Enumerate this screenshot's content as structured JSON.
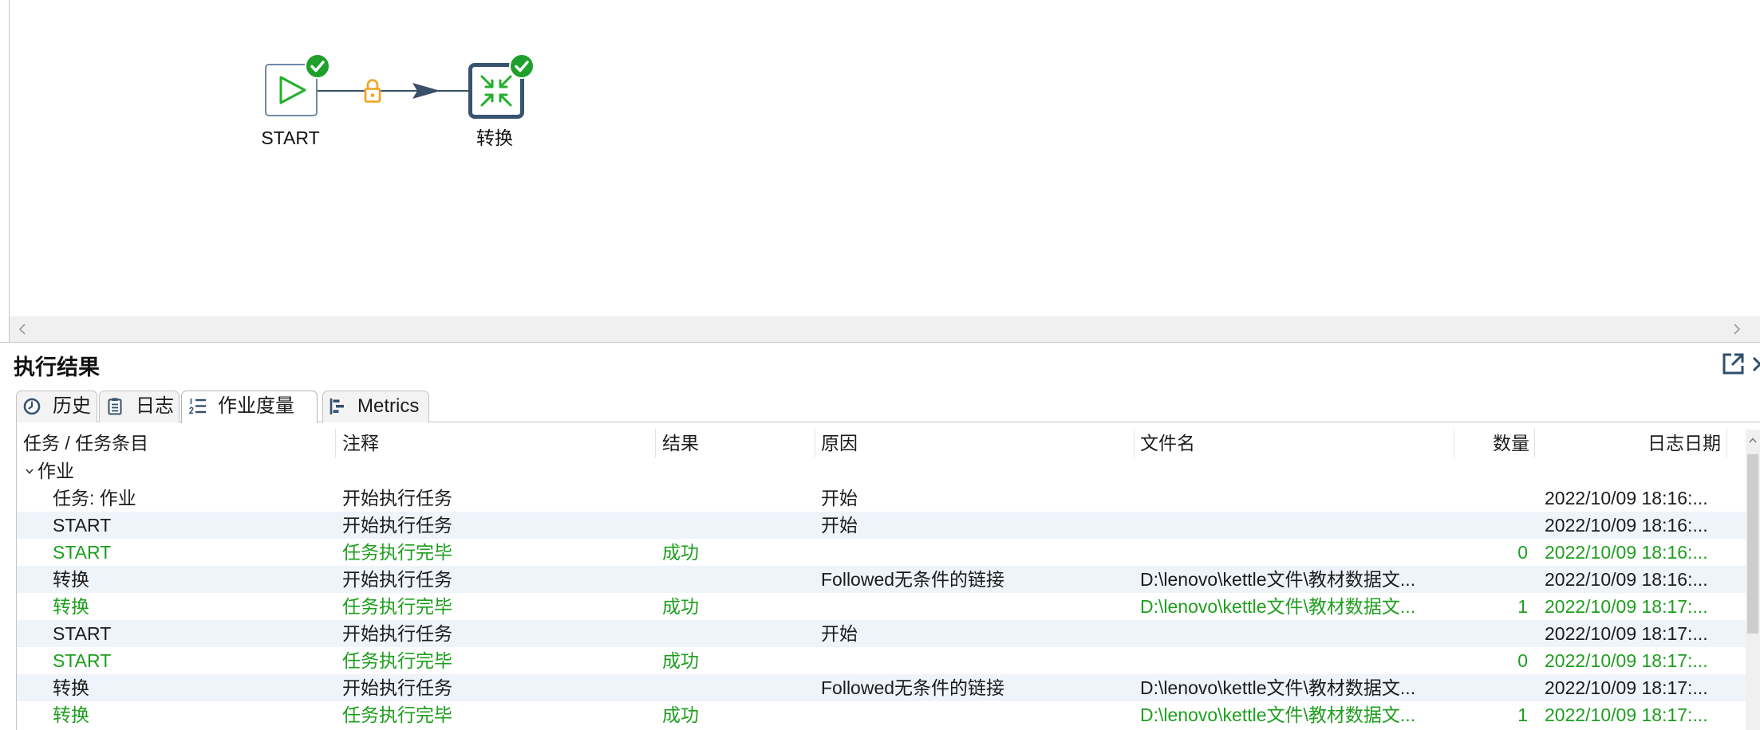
{
  "canvas": {
    "start_node": {
      "label": "START",
      "icon": "play-icon",
      "status": "success"
    },
    "transform_node": {
      "label": "转换",
      "icon": "compress-arrows-icon",
      "status": "success"
    },
    "hop": {
      "icon": "lock-icon",
      "arrow": "arrow-head-icon"
    },
    "hscroll": {
      "left_icon": "chevron-left-icon",
      "right_icon": "chevron-right-icon"
    }
  },
  "panel": {
    "title": "执行结果",
    "actions": [
      "external-link-icon",
      "close-icon"
    ],
    "tabs": [
      {
        "label": "历史",
        "icon": "clock-icon",
        "active": false
      },
      {
        "label": "日志",
        "icon": "log-document-icon",
        "active": false
      },
      {
        "label": "作业度量",
        "icon": "numbered-list-icon",
        "active": true
      },
      {
        "label": "Metrics",
        "icon": "gantt-chart-icon",
        "active": false
      }
    ]
  },
  "table": {
    "columns": [
      "任务 / 任务条目",
      "注释",
      "结果",
      "原因",
      "文件名",
      "数量",
      "日志日期"
    ],
    "group": {
      "label": "作业",
      "expanded": true
    },
    "rows": [
      {
        "task": "任务: 作业",
        "comment": "开始执行任务",
        "result": "",
        "reason": "开始",
        "file": "",
        "count": "",
        "date": "2022/10/09 18:16:...",
        "success": false
      },
      {
        "task": "START",
        "comment": "开始执行任务",
        "result": "",
        "reason": "开始",
        "file": "",
        "count": "",
        "date": "2022/10/09 18:16:...",
        "success": false
      },
      {
        "task": "START",
        "comment": "任务执行完毕",
        "result": "成功",
        "reason": "",
        "file": "",
        "count": "0",
        "date": "2022/10/09 18:16:...",
        "success": true
      },
      {
        "task": "转换",
        "comment": "开始执行任务",
        "result": "",
        "reason": "Followed无条件的链接",
        "file": "D:\\lenovo\\kettle文件\\教材数据文...",
        "count": "",
        "date": "2022/10/09 18:16:...",
        "success": false
      },
      {
        "task": "转换",
        "comment": "任务执行完毕",
        "result": "成功",
        "reason": "",
        "file": "D:\\lenovo\\kettle文件\\教材数据文...",
        "count": "1",
        "date": "2022/10/09 18:17:...",
        "success": true
      },
      {
        "task": "START",
        "comment": "开始执行任务",
        "result": "",
        "reason": "开始",
        "file": "",
        "count": "",
        "date": "2022/10/09 18:17:...",
        "success": false
      },
      {
        "task": "START",
        "comment": "任务执行完毕",
        "result": "成功",
        "reason": "",
        "file": "",
        "count": "0",
        "date": "2022/10/09 18:17:...",
        "success": true
      },
      {
        "task": "转换",
        "comment": "开始执行任务",
        "result": "",
        "reason": "Followed无条件的链接",
        "file": "D:\\lenovo\\kettle文件\\教材数据文...",
        "count": "",
        "date": "2022/10/09 18:17:...",
        "success": false
      },
      {
        "task": "转换",
        "comment": "任务执行完毕",
        "result": "成功",
        "reason": "",
        "file": "D:\\lenovo\\kettle文件\\教材数据文...",
        "count": "1",
        "date": "2022/10/09 18:17:...",
        "success": true
      }
    ]
  },
  "colors": {
    "success_text": "#1e9e1e",
    "row_stripe": "#eef4fa",
    "success_badge": "#1f9f2b",
    "lock": "#f3a21c",
    "node_border": "#385370",
    "icon": "#34506c"
  }
}
